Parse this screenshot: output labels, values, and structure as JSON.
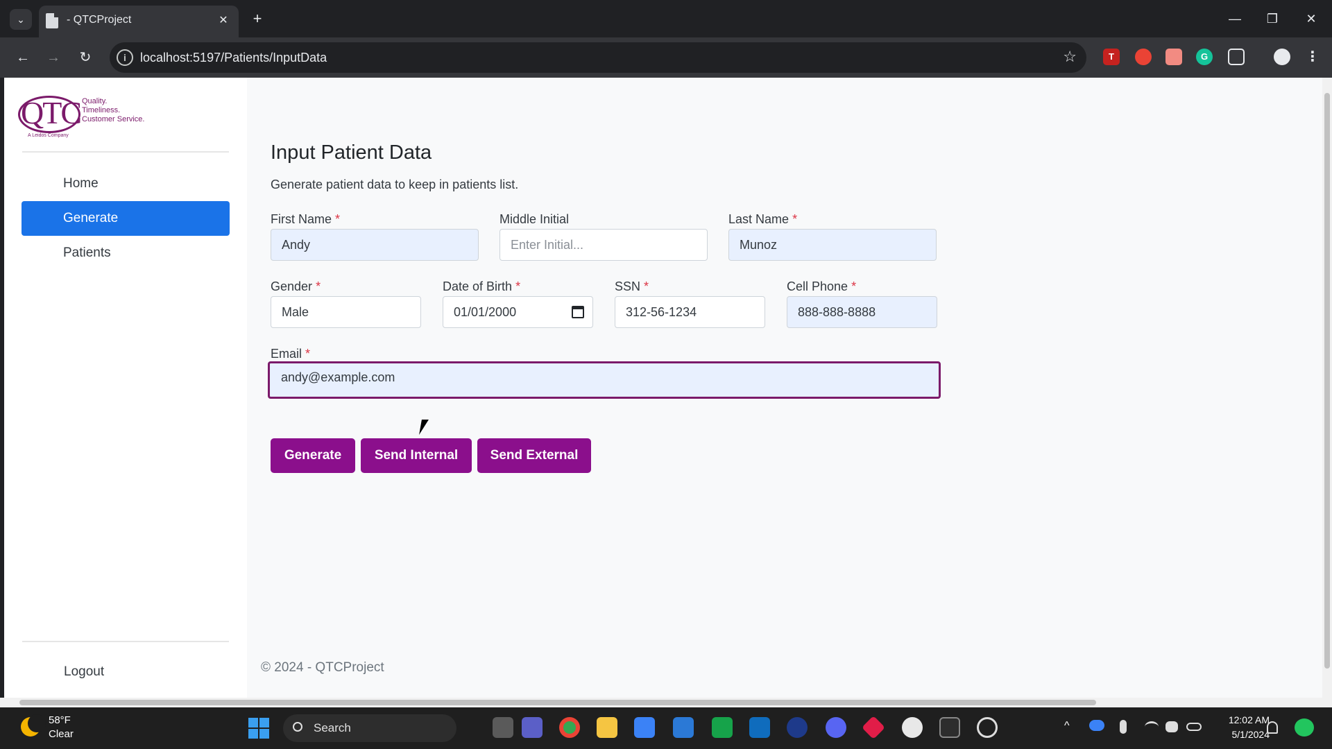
{
  "browser": {
    "tab_title": "- QTCProject",
    "tab_close": "✕",
    "new_tab": "+",
    "url": "localhost:5197/Patients/InputData",
    "back": "←",
    "forward": "→",
    "reload": "↻",
    "bookmark": "☆",
    "win_min": "—",
    "win_restore": "❐",
    "win_close": "✕",
    "tab_list": "⌄"
  },
  "logo": {
    "mark": "QTC",
    "tagline": [
      "Quality.",
      "Timeliness.",
      "Customer Service."
    ],
    "sub": "A Leidos Company",
    "brand_color": "#7b1a6a"
  },
  "sidebar": {
    "items": [
      {
        "label": "Home",
        "active": false
      },
      {
        "label": "Generate",
        "active": true
      },
      {
        "label": "Patients",
        "active": false
      }
    ],
    "logout": "Logout",
    "active_color": "#1a73e8"
  },
  "page": {
    "title": "Input Patient Data",
    "description": "Generate patient data to keep in patients list."
  },
  "form": {
    "required_marker": "*",
    "first_name": {
      "label": "First Name",
      "value": "Andy"
    },
    "middle_initial": {
      "label": "Middle Initial",
      "placeholder": "Enter Initial..."
    },
    "last_name": {
      "label": "Last Name",
      "value": "Munoz"
    },
    "gender": {
      "label": "Gender",
      "value": "Male"
    },
    "dob": {
      "label": "Date of Birth",
      "value": "01/01/2000"
    },
    "ssn": {
      "label": "SSN",
      "value": "312-56-1234"
    },
    "cell_phone": {
      "label": "Cell Phone",
      "value": "888-888-8888"
    },
    "email": {
      "label": "Email",
      "value": "andy@example.com"
    }
  },
  "buttons": {
    "generate": "Generate",
    "send_internal": "Send Internal",
    "send_external": "Send External",
    "color": "#8b0f8c"
  },
  "footer": "© 2024 - QTCProject",
  "taskbar": {
    "weather_temp": "58°F",
    "weather_condition": "Clear",
    "search_label": "Search",
    "time": "12:02 AM",
    "date": "5/1/2024"
  }
}
